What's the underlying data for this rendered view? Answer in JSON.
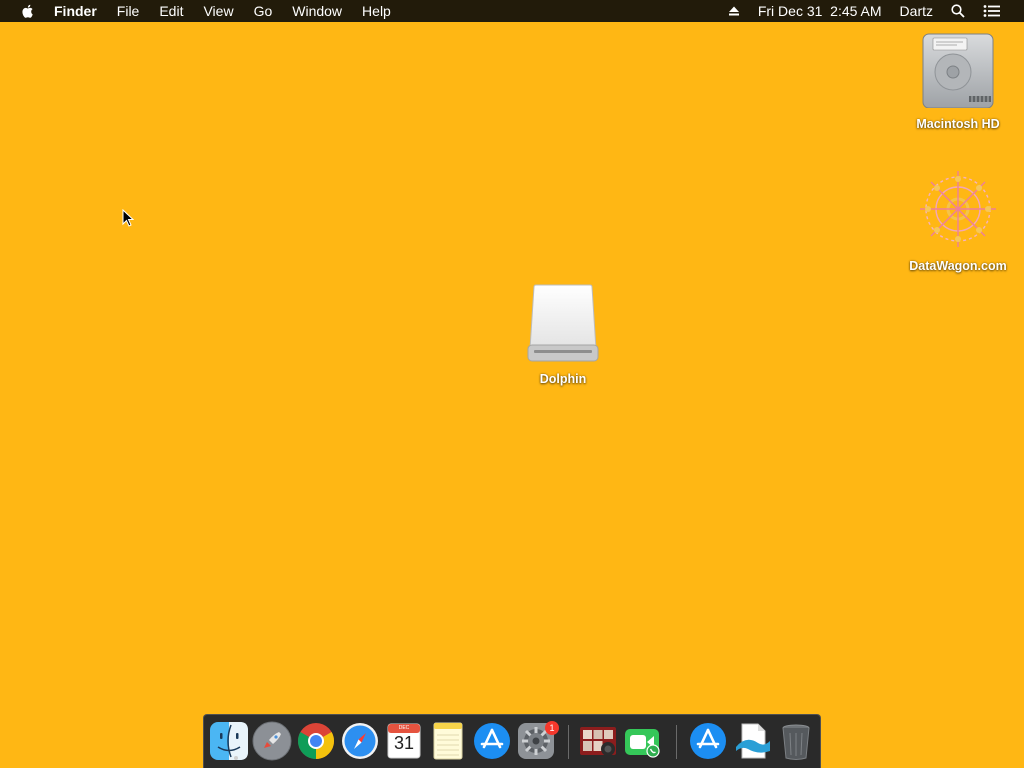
{
  "menubar": {
    "apple_icon": "apple-logo-icon",
    "app_name": "Finder",
    "menus": [
      "File",
      "Edit",
      "View",
      "Go",
      "Window",
      "Help"
    ],
    "datetime": "Fri Dec 31  2:45 AM",
    "user": "Dartz",
    "icons": [
      "eject-icon",
      "spotlight-search-icon",
      "notification-center-icon"
    ]
  },
  "desktop": {
    "background_color": "#ffb714",
    "icons": [
      {
        "label": "Macintosh HD",
        "icon": "hard-drive-icon"
      },
      {
        "label": "DataWagon.com",
        "icon": "mandala-network-icon"
      },
      {
        "label": "Dolphin",
        "icon": "external-drive-icon"
      }
    ]
  },
  "dock": {
    "apps": [
      {
        "name": "Finder",
        "icon": "finder-icon",
        "running": true
      },
      {
        "name": "Launchpad",
        "icon": "launchpad-rocket-icon"
      },
      {
        "name": "Google Chrome",
        "icon": "chrome-icon"
      },
      {
        "name": "Safari",
        "icon": "safari-compass-icon"
      },
      {
        "name": "Calendar",
        "icon": "calendar-icon",
        "month": "DEC",
        "day": "31"
      },
      {
        "name": "Notes",
        "icon": "notes-icon"
      },
      {
        "name": "App Store",
        "icon": "app-store-icon"
      },
      {
        "name": "System Preferences",
        "icon": "gear-icon",
        "badge": "1"
      },
      {
        "name": "Photo Booth",
        "icon": "photo-booth-icon"
      },
      {
        "name": "FaceTime",
        "icon": "facetime-icon"
      },
      {
        "name": "App Store Downloads",
        "icon": "app-store-icon"
      },
      {
        "name": "Document Viewer",
        "icon": "document-wave-icon"
      },
      {
        "name": "Trash",
        "icon": "trash-icon"
      }
    ]
  }
}
